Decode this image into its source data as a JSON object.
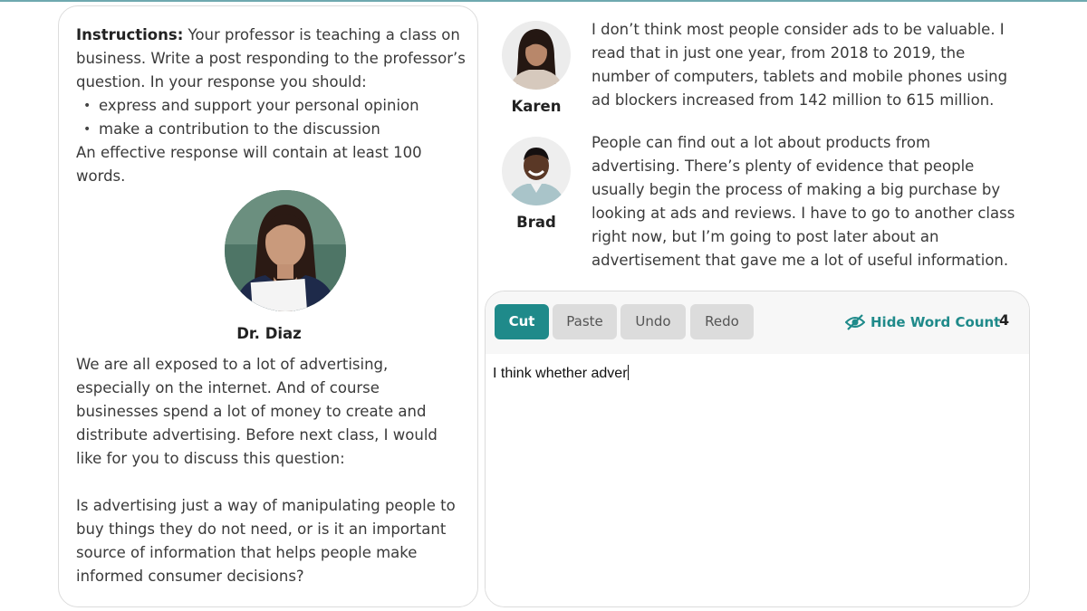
{
  "instructions": {
    "label": "Instructions:",
    "text": " Your professor is teaching a class on business. Write a post responding to the professor’s question. In your response you should:",
    "bullets": [
      "express and support your personal opinion",
      "make a contribution to the discussion"
    ],
    "footer": "An effective response will contain at least 100 words."
  },
  "professor": {
    "name": "Dr. Diaz",
    "paragraph1": "We are all exposed to a lot of advertising, especially on the internet. And of course businesses spend a lot of money to create and distribute advertising. Before next class, I would like for you to discuss this question:",
    "paragraph2": "Is advertising just a way of manipulating people to buy things they do not need, or is it an important source of information that helps people make informed consumer decisions?"
  },
  "posts": [
    {
      "name": "Karen",
      "text": "I don’t think most people consider ads to be valuable. I read that in just one year, from 2018 to 2019, the number of computers, tablets and mobile phones using ad blockers increased from 142 million to 615 million."
    },
    {
      "name": "Brad",
      "text": "People can find out a lot about products from advertising. There’s plenty of evidence that people usually begin the process of making a big purchase by looking at ads and reviews. I have to go to another class right now, but I’m going to post later about an advertisement that gave me a lot of useful information."
    }
  ],
  "editor": {
    "buttons": {
      "cut": "Cut",
      "paste": "Paste",
      "undo": "Undo",
      "redo": "Redo"
    },
    "hide_word_count": "Hide Word Count",
    "word_count": "4",
    "response_text": "I think whether adver"
  },
  "colors": {
    "accent": "#1f8a8a",
    "button_gray": "#dcdcdc",
    "toolbar_bg": "#f7f7f7"
  },
  "icons": {
    "hide_word_count": "eye-slash-icon"
  }
}
